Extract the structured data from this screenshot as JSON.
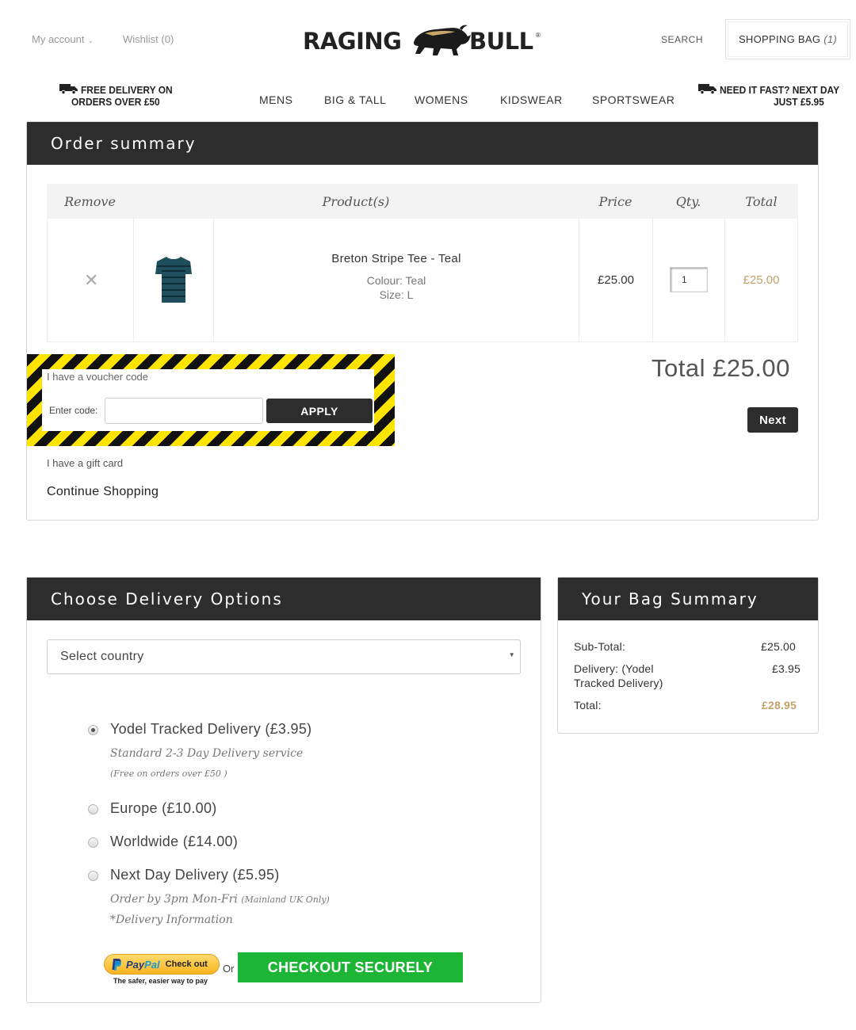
{
  "header": {
    "my_account": "My account",
    "wishlist": "Wishlist (0)",
    "logo_left": "RAGING",
    "logo_right": "BULL",
    "logo_mark": "®",
    "search": "SEARCH",
    "bag_label": "SHOPPING BAG",
    "bag_count": "(1)"
  },
  "promo_left": {
    "line1": "FREE DELIVERY ON",
    "line2": "ORDERS OVER £50"
  },
  "promo_right": {
    "line1": "NEED IT FAST? NEXT DAY",
    "line2": "JUST £5.95"
  },
  "nav": [
    "MENS",
    "BIG & TALL",
    "WOMENS",
    "KIDSWEAR",
    "SPORTSWEAR"
  ],
  "order": {
    "title": "Order summary",
    "columns": {
      "remove": "Remove",
      "products": "Product(s)",
      "price": "Price",
      "qty": "Qty.",
      "total": "Total"
    },
    "item": {
      "name": "Breton Stripe Tee - Teal",
      "colour": "Colour: Teal",
      "size": "Size: L",
      "price": "£25.00",
      "qty": "1",
      "total": "£25.00"
    },
    "voucher_heading": "I have a voucher code",
    "enter_code": "Enter code:",
    "apply": "APPLY",
    "total_text": "Total £25.00",
    "next": "Next",
    "gift_card": "I have a gift card",
    "continue": "Continue Shopping"
  },
  "delivery": {
    "title": "Choose Delivery Options",
    "country_placeholder": "Select country",
    "options": [
      {
        "label": "Yodel Tracked Delivery (£3.95)",
        "sub": "Standard 2-3 Day Delivery service",
        "note": "(Free on orders over £50 )",
        "selected": true
      },
      {
        "label": "Europe (£10.00)"
      },
      {
        "label": "Worldwide (£14.00)"
      },
      {
        "label": "Next Day Delivery (£5.95)",
        "sub": "Order by 3pm Mon-Fri",
        "sub_small": "(Mainland UK Only)",
        "info": "*Delivery Information"
      }
    ],
    "paypal_brand_a": "Pay",
    "paypal_brand_b": "Pal",
    "paypal_check": "Check out",
    "paypal_tagline": "The safer, easier way to pay",
    "or": "Or",
    "checkout": "CHECKOUT SECURELY"
  },
  "bag_summary": {
    "title": "Your Bag Summary",
    "subtotal_label": "Sub-Total:",
    "subtotal": "£25.00",
    "delivery_label_1": "Delivery: (Yodel",
    "delivery_label_2": "Tracked Delivery)",
    "delivery": "£3.95",
    "total_label": "Total:",
    "total": "£28.95"
  },
  "colors": {
    "accent_gold": "#c4a06a",
    "dark": "#2d2d2d",
    "checkout_green": "#1db535",
    "hazard_yellow": "#ffe400"
  }
}
